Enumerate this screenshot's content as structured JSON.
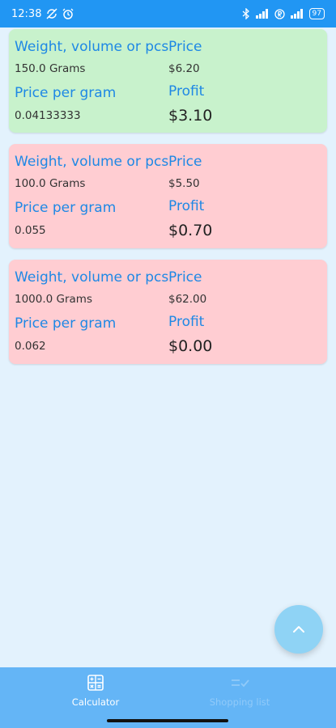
{
  "status_bar": {
    "time": "12:38",
    "battery": "97",
    "icons": [
      "no-sync-icon",
      "alarm-icon",
      "bluetooth-icon",
      "cell-signal-icon",
      "r-badge-icon",
      "cell-signal-icon",
      "battery-icon"
    ]
  },
  "labels": {
    "weight": "Weight, volume or pcs",
    "price": "Price",
    "price_per": "Price per gram",
    "profit": "Profit"
  },
  "cards": [
    {
      "status": "profit",
      "weight": "150.0 Grams",
      "price": "$6.20",
      "price_per": "0.04133333",
      "profit": "$3.10",
      "color": "#c8f2cc"
    },
    {
      "status": "loss",
      "weight": "100.0 Grams",
      "price": "$5.50",
      "price_per": "0.055",
      "profit": "$0.70",
      "color": "#ffcdd2"
    },
    {
      "status": "loss",
      "weight": "1000.0 Grams",
      "price": "$62.00",
      "price_per": "0.062",
      "profit": "$0.00",
      "color": "#ffcdd2"
    }
  ],
  "fab": {
    "icon": "chevron-up-icon"
  },
  "bottom_nav": {
    "items": [
      {
        "label": "Calculator",
        "icon": "calculator-icon",
        "active": true
      },
      {
        "label": "Shopping list",
        "icon": "checklist-icon",
        "active": false
      }
    ]
  },
  "colors": {
    "status_bar": "#2196f3",
    "background": "#e3f2fd",
    "label_blue": "#1e88e5",
    "nav": "#64b5f6"
  }
}
